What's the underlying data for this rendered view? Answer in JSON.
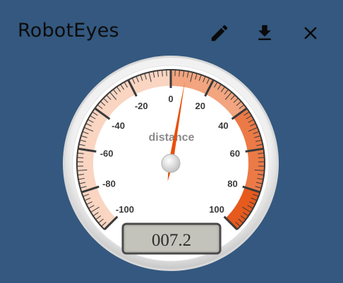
{
  "window": {
    "title": "RobotEyes",
    "buttons": [
      {
        "name": "edit",
        "icon": "pencil-icon"
      },
      {
        "name": "download",
        "icon": "download-icon"
      },
      {
        "name": "close",
        "icon": "close-icon"
      }
    ]
  },
  "gauge": {
    "label": "distance",
    "display_value": "007.2",
    "value": 7.2,
    "min": -100,
    "max": 100,
    "ticks": [
      "-100",
      "-80",
      "-60",
      "-40",
      "-20",
      "0",
      "20",
      "40",
      "60",
      "80",
      "100"
    ],
    "bands": [
      {
        "from": -100,
        "to": 0,
        "color": "#f9d5c2"
      },
      {
        "from": 0,
        "to": 40,
        "color": "#f2a57f"
      },
      {
        "from": 40,
        "to": 80,
        "color": "#ec7a47"
      },
      {
        "from": 80,
        "to": 100,
        "color": "#e65a1e"
      }
    ],
    "needle_color": "#e84f0b"
  },
  "colors": {
    "background": "#34587f",
    "title": "#0c0c0c"
  }
}
